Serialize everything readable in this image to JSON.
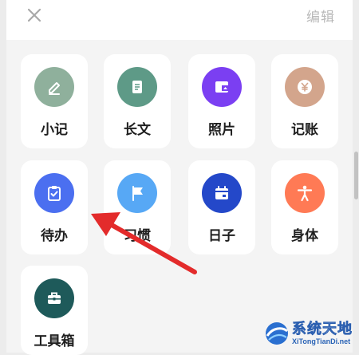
{
  "header": {
    "edit_label": "编辑"
  },
  "tiles": [
    {
      "label": "小记",
      "icon": "pen-icon",
      "color": "#8fb09c"
    },
    {
      "label": "长文",
      "icon": "document-icon",
      "color": "#5e9a87"
    },
    {
      "label": "照片",
      "icon": "photo-icon",
      "color": "#7b3ff2"
    },
    {
      "label": "记账",
      "icon": "yen-icon",
      "color": "#d3a58c"
    },
    {
      "label": "待办",
      "icon": "clipboard-check-icon",
      "color": "#4b6ff0"
    },
    {
      "label": "习惯",
      "icon": "flag-icon",
      "color": "#57a8f5"
    },
    {
      "label": "日子",
      "icon": "calendar-icon",
      "color": "#2448c9"
    },
    {
      "label": "身体",
      "icon": "person-icon",
      "color": "#ff7a55"
    },
    {
      "label": "工具箱",
      "icon": "toolbox-icon",
      "color": "#1e5a5a"
    }
  ],
  "watermark": {
    "title": "系统天地",
    "url": "XiTongTianDi.net"
  }
}
